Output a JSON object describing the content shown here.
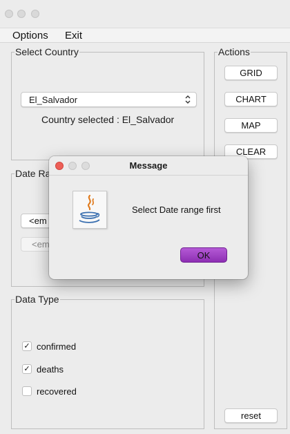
{
  "menu": {
    "options": "Options",
    "exit": "Exit"
  },
  "select_country": {
    "legend": "Select Country",
    "selected_value": "El_Salvador",
    "status_text": "Country selected : El_Salvador"
  },
  "date_range": {
    "legend_partial": "Date Ra",
    "start_button_partial": "<em",
    "end_button_partial": "<em"
  },
  "data_type": {
    "legend": "Data Type",
    "items": [
      {
        "label": "confirmed",
        "checked": true
      },
      {
        "label": "deaths",
        "checked": true
      },
      {
        "label": "recovered",
        "checked": false
      }
    ]
  },
  "actions": {
    "legend": "Actions",
    "grid": "GRID",
    "chart": "CHART",
    "map": "MAP",
    "clear": "CLEAR",
    "reset": "reset"
  },
  "dialog": {
    "title": "Message",
    "message": "Select Date range first",
    "ok": "OK",
    "icon": "java-icon",
    "close_color": "#ed5f57",
    "ok_color": "#a344c9"
  },
  "icons": {
    "check": "checkmark-icon",
    "chevron": "updown-chevron-icon"
  }
}
